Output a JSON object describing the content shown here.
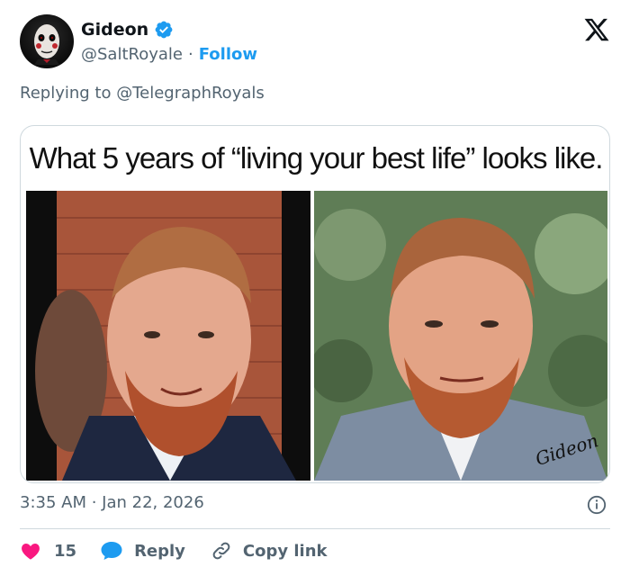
{
  "author": {
    "display_name": "Gideon",
    "handle": "@SaltRoyale",
    "separator": "·",
    "follow_label": "Follow",
    "verified": true,
    "avatar_icon": "avatar-jigsaw-puppet"
  },
  "brand_icon": "x-logo",
  "reply_context": {
    "prefix": "Replying to ",
    "mention": "@TelegraphRoyals"
  },
  "media": {
    "caption": "What 5 years of “living your best life” looks like.",
    "watermark": "Gideon"
  },
  "meta": {
    "timestamp": "3:35 AM · Jan 22, 2026",
    "info_icon": "info-icon"
  },
  "actions": {
    "like_count": "15",
    "reply_label": "Reply",
    "copy_link_label": "Copy link"
  },
  "colors": {
    "accent": "#1d9bf0",
    "like": "#f91880",
    "secondary_text": "#536471",
    "primary_text": "#0f1419",
    "border": "#cfd9de"
  }
}
